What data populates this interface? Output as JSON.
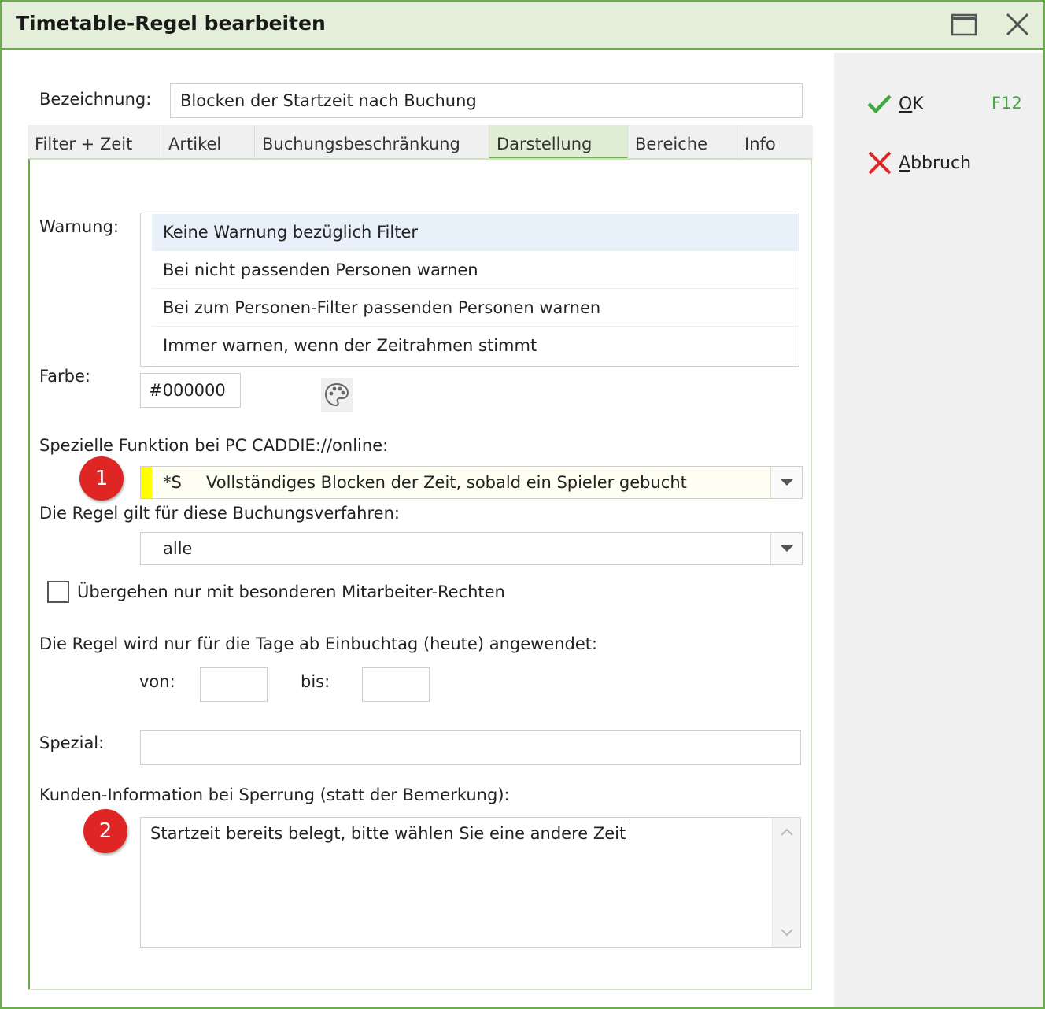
{
  "window": {
    "title": "Timetable-Regel bearbeiten"
  },
  "sidebar": {
    "ok_label_underlined": "O",
    "ok_label_rest": "K",
    "ok_shortcut": "F12",
    "cancel_label_underlined": "A",
    "cancel_label_rest": "bbruch"
  },
  "form": {
    "bezeichnung_label": "Bezeichnung:",
    "bezeichnung_value": "Blocken der Startzeit nach Buchung",
    "tabs": [
      "Filter + Zeit",
      "Artikel",
      "Buchungsbeschränkung",
      "Darstellung",
      "Bereiche",
      "Info"
    ],
    "active_tab": "Darstellung",
    "warnung_label": "Warnung:",
    "warnung_options": [
      "Keine Warnung bezüglich Filter",
      "Bei nicht passenden Personen warnen",
      "Bei zum Personen-Filter passenden Personen warnen",
      "Immer warnen, wenn der Zeitrahmen stimmt"
    ],
    "warnung_selected": "Keine Warnung bezüglich Filter",
    "farbe_label": "Farbe:",
    "farbe_value": "#000000",
    "spezielle_label": "Spezielle Funktion bei PC CADDIE://online:",
    "spezielle_code": "*S",
    "spezielle_value": "Vollständiges Blocken der Zeit, sobald ein Spieler gebucht",
    "buchungsverfahren_label": "Die Regel gilt für diese Buchungsverfahren:",
    "buchungsverfahren_value": "alle",
    "checkbox_label": "Übergehen nur mit besonderen Mitarbeiter-Rechten",
    "checkbox_checked": false,
    "tage_label": "Die Regel wird nur für die Tage ab Einbuchtag (heute) angewendet:",
    "von_label": "von:",
    "von_value": "",
    "bis_label": "bis:",
    "bis_value": "",
    "spezial_label": "Spezial:",
    "spezial_value": "",
    "kunden_label": "Kunden-Information bei Sperrung (statt der Bemerkung):",
    "kunden_value": "Startzeit bereits belegt, bitte wählen Sie eine andere Zeit"
  },
  "annotations": {
    "badge1": "1",
    "badge2": "2"
  },
  "colors": {
    "accent_green": "#6aae4c",
    "titlebar_bg": "#e3efd9",
    "highlight_yellow": "#ffff00",
    "badge_red": "#e02525",
    "ok_check": "#3da83d",
    "cancel_x": "#e02525"
  },
  "icons": {
    "maximize": "maximize-icon",
    "close": "close-icon",
    "ok": "checkmark-icon",
    "cancel": "cross-icon",
    "palette": "palette-icon",
    "dropdown": "chevron-down-icon"
  }
}
